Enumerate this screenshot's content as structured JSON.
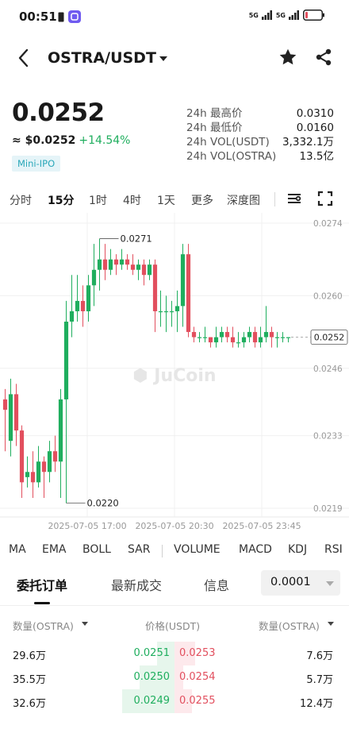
{
  "status": {
    "time": "00:51",
    "net1": "5G",
    "net2": "5G"
  },
  "header": {
    "pair": "OSTRA/USDT"
  },
  "price": {
    "last": "0.0252",
    "fiat": "≈ $0.0252",
    "change": "+14.54%",
    "badge": "Mini-IPO"
  },
  "stats": [
    {
      "label": "24h 最高价",
      "value": "0.0310"
    },
    {
      "label": "24h 最低价",
      "value": "0.0160"
    },
    {
      "label": "24h VOL(USDT)",
      "value": "3,332.1万"
    },
    {
      "label": "24h VOL(OSTRA)",
      "value": "13.5亿"
    }
  ],
  "timeframes": [
    "分时",
    "15分",
    "1时",
    "4时",
    "1天",
    "更多",
    "深度图"
  ],
  "timeframe_active": "15分",
  "chart": {
    "y_ticks": [
      "0.0274",
      "0.0260",
      "0.0246",
      "0.0233",
      "0.0219"
    ],
    "x_ticks": [
      "2025-07-05 17:00",
      "2025-07-05 20:30",
      "2025-07-05 23:45"
    ],
    "high_label": "0.0271",
    "low_label": "0.0220",
    "current_label": "0.0252",
    "watermark": "JuCoin",
    "up_color": "#1fae5e",
    "down_color": "#e24f5e",
    "candles": [
      [
        0.024,
        0.0238,
        0.0242,
        0.023
      ],
      [
        0.0232,
        0.0241,
        0.0244,
        0.0229
      ],
      [
        0.0241,
        0.0234,
        0.0243,
        0.0231
      ],
      [
        0.0234,
        0.0224,
        0.0235,
        0.0221
      ],
      [
        0.0225,
        0.0226,
        0.0229,
        0.0223
      ],
      [
        0.0226,
        0.0224,
        0.023,
        0.0221
      ],
      [
        0.0224,
        0.0228,
        0.0231,
        0.0223
      ],
      [
        0.0228,
        0.0226,
        0.0229,
        0.0221
      ],
      [
        0.0226,
        0.023,
        0.0232,
        0.0224
      ],
      [
        0.023,
        0.0228,
        0.0233,
        0.0226
      ],
      [
        0.0228,
        0.024,
        0.0242,
        0.0221
      ],
      [
        0.024,
        0.0255,
        0.0259,
        0.022
      ],
      [
        0.0255,
        0.0257,
        0.0264,
        0.0252
      ],
      [
        0.0257,
        0.0259,
        0.0264,
        0.0255
      ],
      [
        0.0259,
        0.0257,
        0.0262,
        0.0254
      ],
      [
        0.0257,
        0.0262,
        0.0264,
        0.0255
      ],
      [
        0.0262,
        0.0265,
        0.027,
        0.0258
      ],
      [
        0.0265,
        0.0267,
        0.0271,
        0.0261
      ],
      [
        0.0267,
        0.0265,
        0.027,
        0.0263
      ],
      [
        0.0265,
        0.0267,
        0.0269,
        0.0264
      ],
      [
        0.0267,
        0.0266,
        0.0268,
        0.0264
      ],
      [
        0.0266,
        0.0267,
        0.0269,
        0.0265
      ],
      [
        0.0267,
        0.0266,
        0.0268,
        0.0265
      ],
      [
        0.0266,
        0.0265,
        0.0268,
        0.0264
      ],
      [
        0.0265,
        0.0266,
        0.0267,
        0.0263
      ],
      [
        0.0266,
        0.0264,
        0.0267,
        0.0262
      ],
      [
        0.0264,
        0.0266,
        0.0267,
        0.0263
      ],
      [
        0.0266,
        0.0257,
        0.0267,
        0.0253
      ],
      [
        0.0257,
        0.0257,
        0.0261,
        0.0254
      ],
      [
        0.0257,
        0.0257,
        0.026,
        0.0253
      ],
      [
        0.0257,
        0.0257,
        0.0259,
        0.0254
      ],
      [
        0.0257,
        0.0258,
        0.0261,
        0.0253
      ],
      [
        0.0258,
        0.0268,
        0.027,
        0.0254
      ],
      [
        0.0268,
        0.0253,
        0.027,
        0.0252
      ],
      [
        0.0253,
        0.0252,
        0.0254,
        0.0251
      ],
      [
        0.0252,
        0.0252,
        0.0253,
        0.0251
      ],
      [
        0.0252,
        0.0252,
        0.0254,
        0.0251
      ],
      [
        0.0252,
        0.0251,
        0.0252,
        0.025
      ],
      [
        0.0251,
        0.0252,
        0.0254,
        0.025
      ],
      [
        0.0252,
        0.0253,
        0.0254,
        0.0251
      ],
      [
        0.0253,
        0.0252,
        0.0254,
        0.0251
      ],
      [
        0.0252,
        0.0251,
        0.0254,
        0.025
      ],
      [
        0.0251,
        0.0251,
        0.0253,
        0.025
      ],
      [
        0.0251,
        0.0252,
        0.0253,
        0.025
      ],
      [
        0.0252,
        0.0253,
        0.0254,
        0.0251
      ],
      [
        0.0253,
        0.0251,
        0.0254,
        0.025
      ],
      [
        0.0251,
        0.0252,
        0.0254,
        0.025
      ],
      [
        0.0252,
        0.0253,
        0.0258,
        0.0251
      ],
      [
        0.0253,
        0.0252,
        0.0254,
        0.025
      ],
      [
        0.0252,
        0.0252,
        0.0253,
        0.025
      ],
      [
        0.0252,
        0.0252,
        0.0253,
        0.0251
      ],
      [
        0.0252,
        0.0252,
        0.0252,
        0.0251
      ]
    ]
  },
  "indicators": [
    "MA",
    "EMA",
    "BOLL",
    "SAR",
    "VOLUME",
    "MACD",
    "KDJ",
    "RSI"
  ],
  "book_tabs": [
    "委托订单",
    "最新成交",
    "信息"
  ],
  "book_tab_active": "委托订单",
  "precision": "0.0001",
  "orderbook_head": {
    "bid_qty": "数量(OSTRA)",
    "price": "价格(USDT)",
    "ask_qty": "数量(OSTRA)"
  },
  "orderbook": [
    {
      "bid_qty": "29.6万",
      "bid_price": "0.0251",
      "ask_price": "0.0253",
      "ask_qty": "7.6万",
      "bid_depth": 0.1,
      "ask_depth": 0.12
    },
    {
      "bid_qty": "35.5万",
      "bid_price": "0.0250",
      "ask_price": "0.0254",
      "ask_qty": "5.7万",
      "bid_depth": 0.2,
      "ask_depth": 0.05
    },
    {
      "bid_qty": "32.6万",
      "bid_price": "0.0249",
      "ask_price": "0.0255",
      "ask_qty": "12.4万",
      "bid_depth": 0.3,
      "ask_depth": 0.1
    }
  ]
}
